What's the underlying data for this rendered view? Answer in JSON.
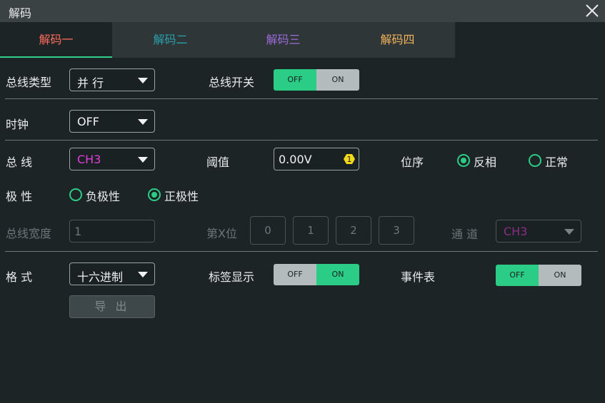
{
  "window": {
    "title": "解码"
  },
  "tabs": [
    {
      "label": "解码一",
      "color": "#ff6b5c"
    },
    {
      "label": "解码二",
      "color": "#2aa0aa"
    },
    {
      "label": "解码三",
      "color": "#9e6ad8"
    },
    {
      "label": "解码四",
      "color": "#f0b25a"
    }
  ],
  "bus_type": {
    "label": "总线类型",
    "value": "并 行"
  },
  "bus_switch": {
    "label": "总线开关",
    "off": "OFF",
    "on": "ON",
    "state": "OFF"
  },
  "clock": {
    "label": "时钟",
    "value": "OFF"
  },
  "bus": {
    "label": "总 线",
    "value": "CH3",
    "value_color": "#e03cd8"
  },
  "threshold": {
    "label": "阈值",
    "value": "0.00V",
    "badge": "1"
  },
  "bit_order": {
    "label": "位序",
    "options": [
      "反相",
      "正常"
    ],
    "selected": "反相"
  },
  "polarity": {
    "label": "极 性",
    "options": [
      "负极性",
      "正极性"
    ],
    "selected": "正极性"
  },
  "bus_width": {
    "label": "总线宽度",
    "value": "1"
  },
  "bit_x": {
    "label": "第X位",
    "bits": [
      "0",
      "1",
      "2",
      "3"
    ]
  },
  "channel": {
    "label": "通 道",
    "value": "CH3"
  },
  "format": {
    "label": "格 式",
    "value": "十六进制"
  },
  "label_display": {
    "label": "标签显示",
    "off": "OFF",
    "on": "ON",
    "state": "ON"
  },
  "event_table": {
    "label": "事件表",
    "off": "OFF",
    "on": "ON",
    "state": "OFF"
  },
  "export": {
    "label": "导 出"
  },
  "colors": {
    "accent": "#2bcd86",
    "ch3": "#e03cd8",
    "bg": "#1c2425"
  }
}
